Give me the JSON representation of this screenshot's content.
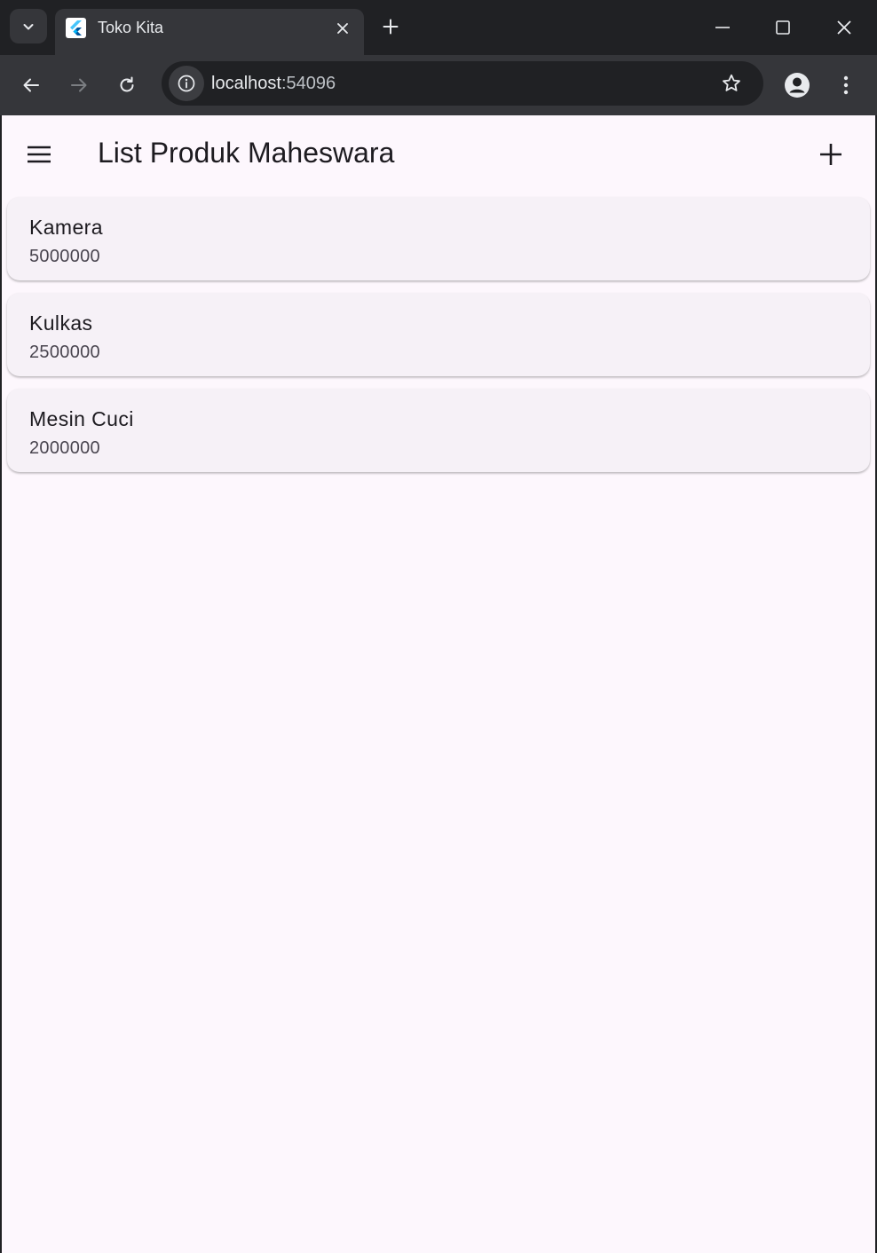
{
  "browser": {
    "tab": {
      "title": "Toko Kita",
      "favicon": "flutter-icon"
    },
    "omnibox": {
      "host": "localhost",
      "port": ":54096"
    },
    "icons": [
      "tab-search-icon",
      "close-icon",
      "plus-icon",
      "minimize-icon",
      "maximize-icon",
      "window-close-icon",
      "back-arrow-icon",
      "forward-arrow-icon",
      "reload-icon",
      "info-icon",
      "star-icon",
      "profile-icon",
      "more-vert-icon"
    ]
  },
  "app": {
    "title": "List Produk Maheswara",
    "icons": {
      "menu": "hamburger-menu-icon",
      "add": "add-icon"
    },
    "colors": {
      "background": "#fdf7fd",
      "card": "#f6f1f7",
      "text": "#1d1b20"
    },
    "products": [
      {
        "name": "Kamera",
        "price": "5000000"
      },
      {
        "name": "Kulkas",
        "price": "2500000"
      },
      {
        "name": "Mesin Cuci",
        "price": "2000000"
      }
    ]
  }
}
